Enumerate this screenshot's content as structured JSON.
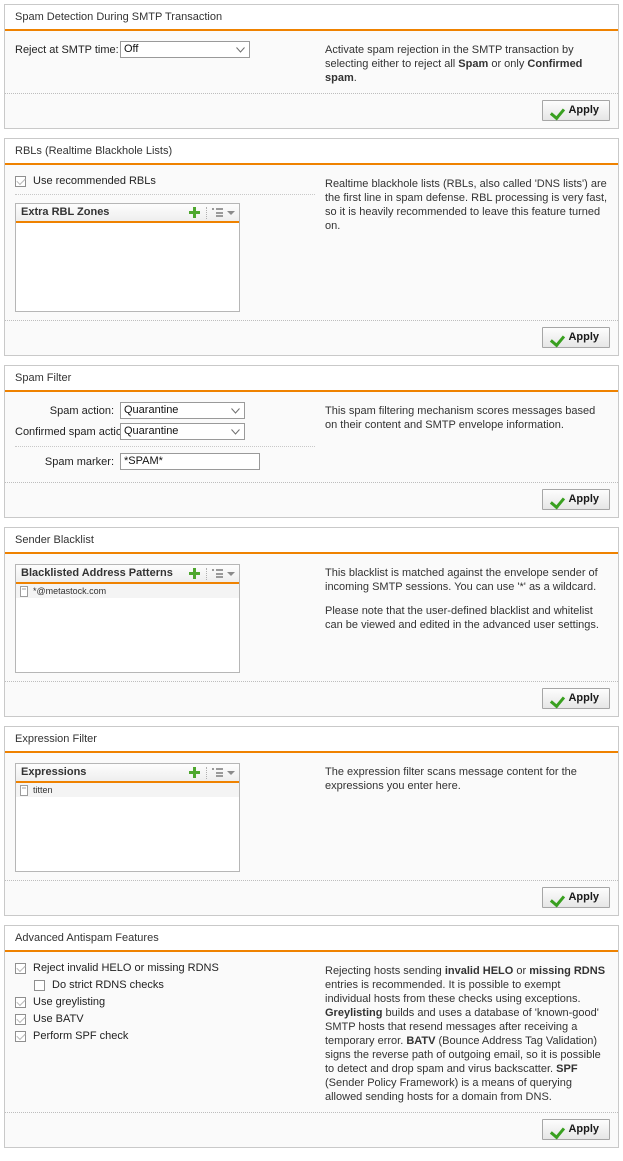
{
  "sections": [
    {
      "id": "smtp",
      "title": "Spam Detection During SMTP Transaction",
      "label_reject": "Reject at SMTP time:",
      "value_reject": "Off",
      "apply": "Apply",
      "desc": [
        {
          "parts": [
            {
              "t": "Activate spam rejection in the SMTP transaction by selecting either to reject all ",
              "b": false
            },
            {
              "t": "Spam",
              "b": true
            },
            {
              "t": " or only ",
              "b": false
            },
            {
              "t": "Confirmed spam",
              "b": true
            },
            {
              "t": ".",
              "b": false
            }
          ]
        }
      ]
    },
    {
      "id": "rbls",
      "title": "RBLs (Realtime Blackhole Lists)",
      "checkbox_label": "Use recommended RBLs",
      "checkbox_checked": true,
      "list_title": "Extra RBL Zones",
      "list_items": [],
      "apply": "Apply",
      "desc": [
        {
          "parts": [
            {
              "t": "Realtime blackhole lists (RBLs, also called 'DNS lists') are the first line in spam defense. RBL processing is very fast, so it is heavily recommended to leave this feature turned on.",
              "b": false
            }
          ]
        }
      ]
    },
    {
      "id": "spamfilter",
      "title": "Spam Filter",
      "label_spam_action": "Spam action:",
      "value_spam_action": "Quarantine",
      "label_confirmed_action": "Confirmed spam action:",
      "value_confirmed_action": "Quarantine",
      "label_marker": "Spam marker:",
      "value_marker": "*SPAM*",
      "apply": "Apply",
      "desc": [
        {
          "parts": [
            {
              "t": "This spam filtering mechanism scores messages based on their content and SMTP envelope information.",
              "b": false
            }
          ]
        }
      ]
    },
    {
      "id": "blacklist",
      "title": "Sender Blacklist",
      "list_title": "Blacklisted Address Patterns",
      "list_items": [
        "*@metastock.com"
      ],
      "apply": "Apply",
      "desc": [
        {
          "parts": [
            {
              "t": "This blacklist is matched against the envelope sender of incoming SMTP sessions. You can use '*' as a wildcard.",
              "b": false
            }
          ]
        },
        {
          "parts": [
            {
              "t": "Please note that the user-defined blacklist and whitelist can be viewed and edited in the advanced user settings.",
              "b": false
            }
          ]
        }
      ]
    },
    {
      "id": "expression",
      "title": "Expression Filter",
      "list_title": "Expressions",
      "list_items": [
        "titten"
      ],
      "apply": "Apply",
      "desc": [
        {
          "parts": [
            {
              "t": "The expression filter scans message content for the expressions you enter here.",
              "b": false
            }
          ]
        }
      ]
    },
    {
      "id": "advanced",
      "title": "Advanced Antispam Features",
      "checkboxes": [
        {
          "label": "Reject invalid HELO or missing RDNS",
          "checked": true,
          "indent": false
        },
        {
          "label": "Do strict RDNS checks",
          "checked": false,
          "indent": true
        },
        {
          "label": "Use greylisting",
          "checked": true,
          "indent": false
        },
        {
          "label": "Use BATV",
          "checked": true,
          "indent": false
        },
        {
          "label": "Perform SPF check",
          "checked": true,
          "indent": false
        }
      ],
      "apply": "Apply",
      "desc": [
        {
          "parts": [
            {
              "t": "Rejecting hosts sending ",
              "b": false
            },
            {
              "t": "invalid HELO",
              "b": true
            },
            {
              "t": " or ",
              "b": false
            },
            {
              "t": "missing RDNS",
              "b": true
            },
            {
              "t": " entries is recommended. It is possible to exempt individual hosts from these checks using exceptions. ",
              "b": false
            },
            {
              "t": "Greylisting",
              "b": true
            },
            {
              "t": " builds and uses a database of 'known-good' SMTP hosts that resend messages after receiving a temporary error. ",
              "b": false
            },
            {
              "t": "BATV",
              "b": true
            },
            {
              "t": " (Bounce Address Tag Validation) signs the reverse path of outgoing email, so it is possible to detect and drop spam and virus backscatter. ",
              "b": false
            },
            {
              "t": "SPF",
              "b": true
            },
            {
              "t": " (Sender Policy Framework) is a means of querying allowed sending hosts for a domain from DNS.",
              "b": false
            }
          ]
        }
      ]
    }
  ],
  "icons": {
    "add": "plus-icon",
    "menu": "list-menu-icon",
    "caret": "chevron-down-icon",
    "apply_check": "checkmark-icon",
    "select_chevron": "chevron-down-icon",
    "list_item": "document-icon"
  },
  "colors": {
    "accent": "#ef8200",
    "panel_bg": "#fafafa",
    "check_green": "#39a020",
    "plus_green": "#4ea72e"
  }
}
